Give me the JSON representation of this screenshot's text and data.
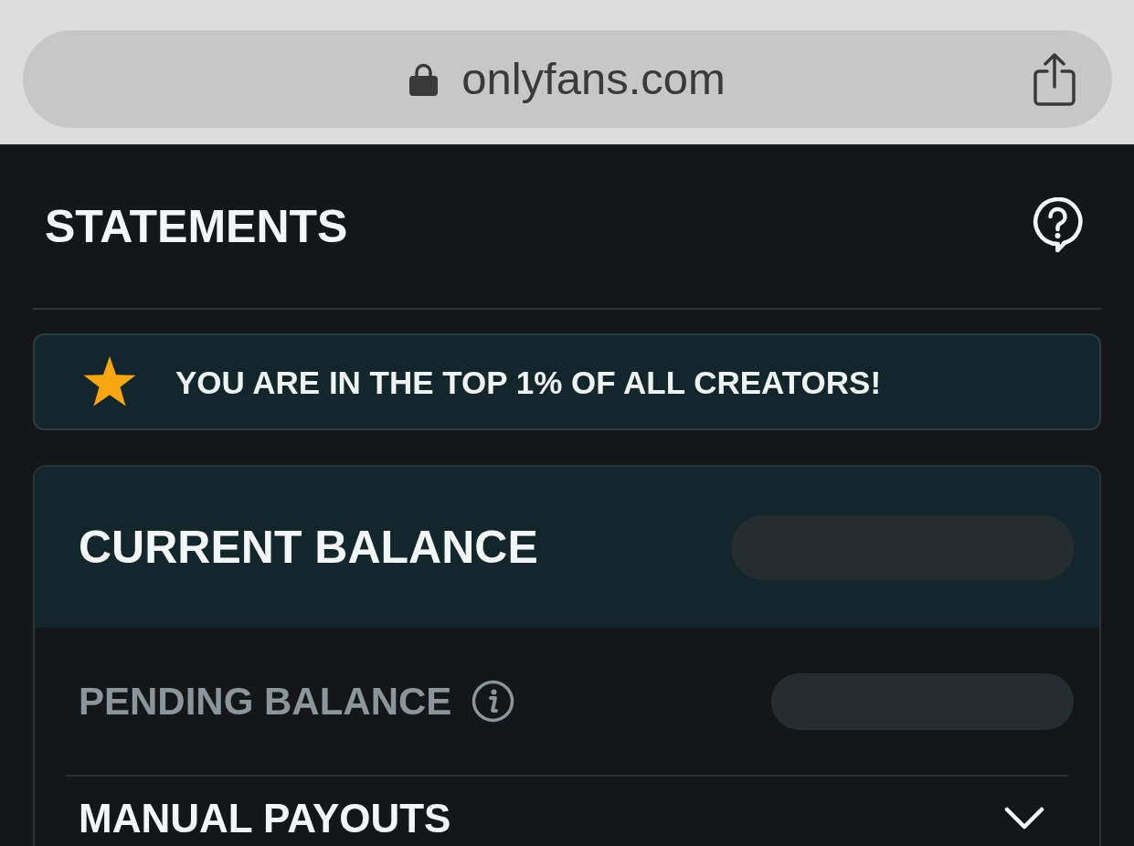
{
  "browser": {
    "url": "onlyfans.com"
  },
  "page": {
    "title": "STATEMENTS"
  },
  "banner": {
    "text": "YOU ARE IN THE TOP 1% OF ALL CREATORS!"
  },
  "balance_card": {
    "header": {
      "label": "CURRENT BALANCE",
      "value_redacted": true
    },
    "rows": [
      {
        "kind": "balance",
        "label": "PENDING BALANCE",
        "value_redacted": true
      },
      {
        "kind": "expander",
        "label": "MANUAL PAYOUTS",
        "expanded": false
      }
    ]
  }
}
